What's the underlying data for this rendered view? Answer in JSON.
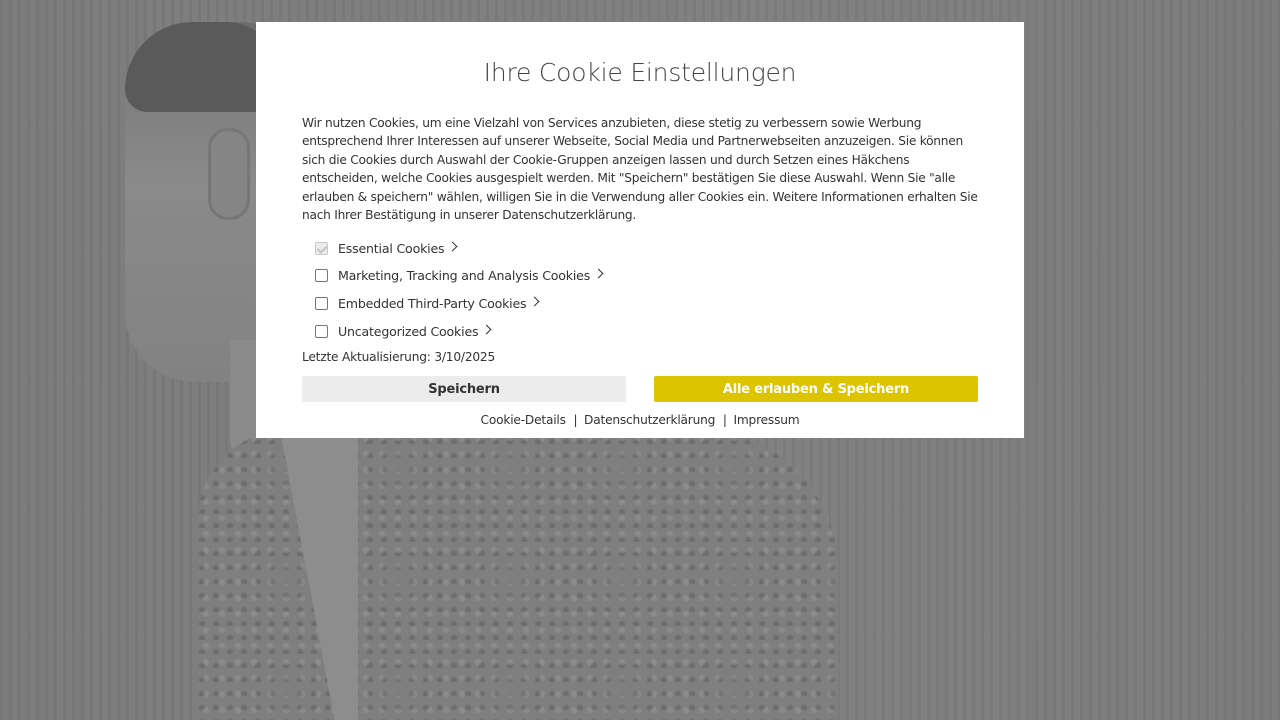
{
  "modal": {
    "title": "Ihre Cookie Einstellungen",
    "description": "Wir nutzen Cookies, um eine Vielzahl von Services anzubieten, diese stetig zu verbessern sowie Werbung entsprechend Ihrer Interessen auf unserer Webseite, Social Media und Partnerwebseiten anzuzeigen. Sie können sich die Cookies durch Auswahl der Cookie-Gruppen anzeigen lassen und durch Setzen eines Häkchens entscheiden, welche Cookies ausgespielt werden. Mit \"Speichern\" bestätigen Sie diese Auswahl. Wenn Sie \"alle erlauben & speichern\" wählen, willigen Sie in die Verwendung aller Cookies ein. Weitere Informationen erhalten Sie nach Ihrer Bestätigung in unserer Datenschutzerklärung.",
    "options": [
      {
        "label": "Essential Cookies",
        "checked": true,
        "disabled": true
      },
      {
        "label": "Marketing, Tracking and Analysis Cookies",
        "checked": false,
        "disabled": false
      },
      {
        "label": "Embedded Third-Party Cookies",
        "checked": false,
        "disabled": false
      },
      {
        "label": "Uncategorized Cookies",
        "checked": false,
        "disabled": false
      }
    ],
    "last_updated": "Letzte Aktualisierung: 3/10/2025",
    "save_label": "Speichern",
    "allow_all_label": "Alle erlauben & Speichern",
    "links": {
      "cookie_details": "Cookie-Details",
      "privacy": "Datenschutzerklärung",
      "imprint": "Impressum",
      "separator": "|"
    }
  },
  "colors": {
    "accent": "#dcc500",
    "overlay": "#7a7a7a",
    "save_button_bg": "#ececec"
  },
  "icons": {
    "option_chevron": "chevron-right-icon"
  }
}
